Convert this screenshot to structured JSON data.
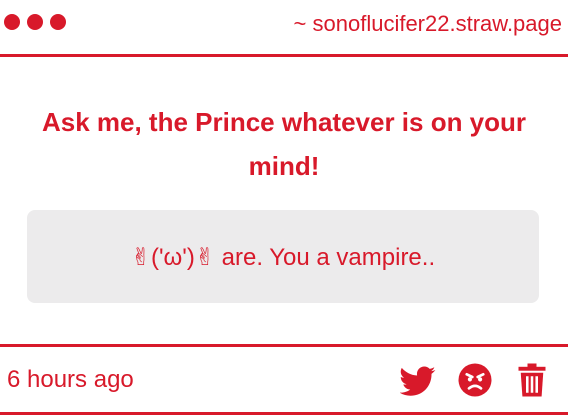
{
  "window": {
    "dots": [
      "dot",
      "dot",
      "dot"
    ],
    "url": "~ sonoflucifer22.straw.page"
  },
  "question": {
    "text": "Ask me, the Prince whatever is on your mind!"
  },
  "answer": {
    "text": "✌('ω')✌ are. You a vampire.."
  },
  "footer": {
    "timestamp": "6 hours ago",
    "icons": [
      "twitter-icon",
      "angry-face-icon",
      "trash-icon"
    ]
  },
  "colors": {
    "accent": "#d8192a",
    "answer_background": "#ecebec",
    "background": "#ffffff"
  }
}
